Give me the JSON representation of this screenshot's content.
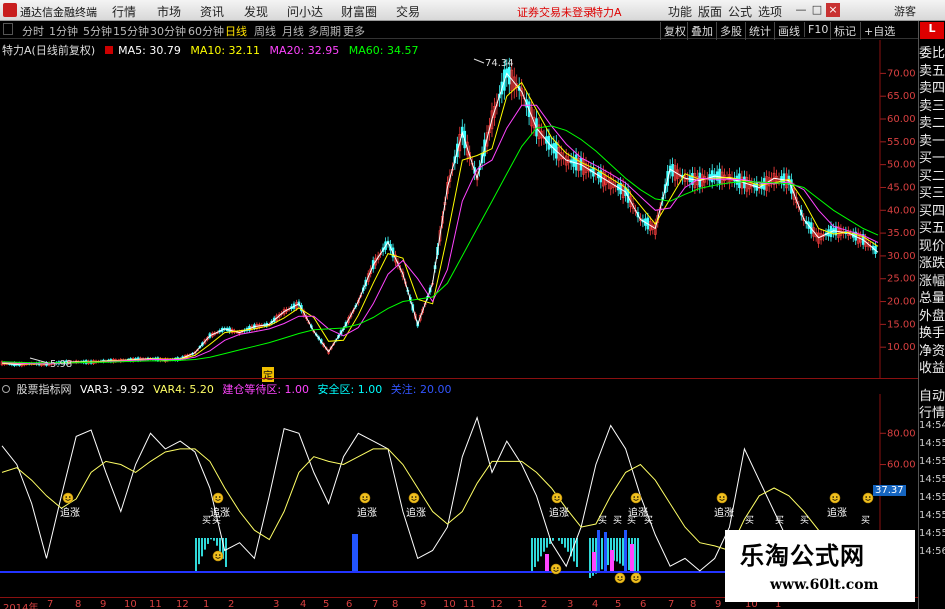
{
  "titlebar": {
    "app_title": "通达信金融终端",
    "menus": [
      "行情",
      "市场",
      "资讯",
      "发现",
      "问小达",
      "财富圈",
      "交易"
    ],
    "status_text": "证券交易未登录",
    "stock_name": "特力A",
    "right_menus": [
      "功能",
      "版面",
      "公式",
      "选项"
    ],
    "user": "游客",
    "win_buttons": [
      "—",
      "□",
      "×"
    ]
  },
  "period_bar": {
    "items": [
      "分时",
      "1分钟",
      "5分钟",
      "15分钟",
      "30分钟",
      "60分钟",
      "日线",
      "周线",
      "月线",
      "多周期",
      "更多"
    ],
    "active": "日线",
    "right_items": [
      "复权",
      "叠加",
      "多股",
      "统计",
      "画线",
      "F10",
      "标记",
      "+自选"
    ],
    "right_box": "L"
  },
  "main_chart": {
    "title": "特力A(日线前复权)",
    "ma": [
      {
        "label": "MA5: 30.79",
        "color": "#ffffff"
      },
      {
        "label": "MA10: 32.11",
        "color": "#ffff00"
      },
      {
        "label": "MA20: 32.95",
        "color": "#ff44ff"
      },
      {
        "label": "MA60: 34.57",
        "color": "#00ff00"
      }
    ],
    "high_label": "74.34",
    "low_label": "5.98",
    "marker": "定"
  },
  "sub_chart": {
    "name": "股票指标网",
    "labels": [
      {
        "label": "VAR3: -9.92",
        "color": "#ffffff"
      },
      {
        "label": "VAR4: 5.20",
        "color": "#ffff66"
      },
      {
        "label": "建仓等待区: 1.00",
        "color": "#ff44ff"
      },
      {
        "label": "安全区: 1.00",
        "color": "#00ffff"
      },
      {
        "label": "关注: 20.00",
        "color": "#3355ff"
      }
    ],
    "signal": "追涨",
    "buy": "买",
    "badge": "37.37"
  },
  "right_panel": {
    "items": [
      "委比",
      "卖五",
      "卖四",
      "卖三",
      "卖二",
      "卖一",
      "买一",
      "买二",
      "买三",
      "买四",
      "买五",
      "现价",
      "涨跌",
      "涨幅",
      "总量",
      "外盘",
      "换手",
      "净资",
      "收益"
    ],
    "lower_items": [
      "自动",
      "行情"
    ],
    "times": [
      "14:54",
      "14:55",
      "14:55",
      "14:55",
      "14:55",
      "14:55",
      "14:55",
      "14:56"
    ],
    "box_label": "L"
  },
  "date_axis": {
    "labels": [
      "2014年",
      "7",
      "8",
      "9",
      "10",
      "11",
      "12",
      "1",
      "2",
      "3",
      "4",
      "5",
      "6",
      "7",
      "8",
      "9",
      "10",
      "11",
      "12",
      "1",
      "2",
      "3",
      "4",
      "5",
      "6",
      "7",
      "8",
      "9",
      "10",
      "1"
    ]
  },
  "watermark": {
    "title": "乐淘公式网",
    "url": "www.60lt.com"
  },
  "chart_data": [
    {
      "type": "line",
      "title": "特力A(日线前复权)",
      "y_ticks": [
        "70.00",
        "65.00",
        "60.00",
        "55.00",
        "50.00",
        "45.00",
        "40.00",
        "35.00",
        "30.00",
        "25.00",
        "20.00",
        "15.00",
        "10.00"
      ],
      "ylim": [
        5,
        76
      ],
      "series": [
        {
          "name": "MA5",
          "color": "#ffffff",
          "values": [
            6.5,
            6.2,
            6.4,
            6.3,
            6.6,
            6.8,
            6.7,
            7.0,
            7.1,
            7.3,
            7.5,
            7.2,
            7.4,
            8.8,
            12.5,
            14.0,
            13.2,
            14.5,
            15.0,
            17.8,
            19.5,
            13.5,
            9.0,
            14.0,
            20.0,
            28.0,
            33.0,
            26.0,
            15.0,
            24.0,
            45.0,
            57.0,
            47.0,
            60.0,
            70.0,
            66.0,
            58.0,
            54.0,
            51.0,
            50.0,
            48.0,
            46.0,
            44.0,
            38.0,
            36.0,
            49.0,
            47.0,
            46.5,
            47.5,
            47.0,
            46.0,
            45.0,
            47.0,
            46.5,
            38.0,
            34.0,
            35.5,
            35.0,
            33.5,
            30.8
          ]
        },
        {
          "name": "MA10",
          "color": "#ffff00",
          "values": [
            6.6,
            6.4,
            6.3,
            6.4,
            6.5,
            6.7,
            6.8,
            6.9,
            7.1,
            7.2,
            7.4,
            7.4,
            7.4,
            8.2,
            10.6,
            13.2,
            13.6,
            14.0,
            14.7,
            16.4,
            18.6,
            16.5,
            11.3,
            11.5,
            17.0,
            24.0,
            30.5,
            29.5,
            20.5,
            19.5,
            34.5,
            51.0,
            52.0,
            53.5,
            65.0,
            68.0,
            62.0,
            56.0,
            52.5,
            50.5,
            49.0,
            47.0,
            45.0,
            41.0,
            37.0,
            42.5,
            48.0,
            46.8,
            47.0,
            47.2,
            46.5,
            45.5,
            46.0,
            46.8,
            42.0,
            36.0,
            34.8,
            35.2,
            34.2,
            32.1
          ]
        },
        {
          "name": "MA20",
          "color": "#ff44ff",
          "values": [
            6.7,
            6.5,
            6.4,
            6.4,
            6.5,
            6.6,
            6.7,
            6.8,
            7.0,
            7.1,
            7.3,
            7.3,
            7.3,
            7.8,
            9.2,
            11.5,
            12.8,
            13.4,
            14.0,
            15.2,
            16.8,
            16.8,
            14.0,
            12.5,
            14.3,
            19.5,
            26.0,
            29.0,
            25.0,
            20.0,
            27.0,
            42.0,
            49.0,
            51.0,
            58.0,
            63.0,
            63.0,
            58.5,
            54.5,
            51.5,
            49.8,
            48.0,
            46.0,
            43.0,
            40.0,
            40.5,
            45.0,
            47.0,
            46.8,
            46.8,
            46.7,
            46.0,
            45.8,
            46.2,
            44.5,
            40.0,
            36.5,
            35.5,
            34.5,
            32.95
          ]
        },
        {
          "name": "MA60",
          "color": "#00ff00",
          "values": [
            6.8,
            6.7,
            6.6,
            6.6,
            6.6,
            6.6,
            6.7,
            6.7,
            6.8,
            6.9,
            7.0,
            7.0,
            7.1,
            7.3,
            7.8,
            8.6,
            9.4,
            10.2,
            11.0,
            12.0,
            13.0,
            13.8,
            14.0,
            14.2,
            15.0,
            16.5,
            18.5,
            20.0,
            20.5,
            21.0,
            24.0,
            30.0,
            36.0,
            42.0,
            48.0,
            54.0,
            58.0,
            58.5,
            57.5,
            55.5,
            53.0,
            50.0,
            47.0,
            44.5,
            42.5,
            42.0,
            43.5,
            44.8,
            45.5,
            46.0,
            46.3,
            46.2,
            46.0,
            45.8,
            45.0,
            42.5,
            40.0,
            38.0,
            36.0,
            34.57
          ]
        }
      ]
    },
    {
      "type": "line",
      "title": "股票指标网",
      "y_ticks": [
        "80.00",
        "60.00"
      ],
      "ylim": [
        -10,
        100
      ],
      "series": [
        {
          "name": "VAR3",
          "color": "#ffffff",
          "values": [
            72,
            60,
            35,
            0,
            40,
            78,
            82,
            55,
            30,
            60,
            80,
            70,
            75,
            68,
            45,
            5,
            10,
            0,
            40,
            83,
            80,
            55,
            35,
            65,
            80,
            75,
            70,
            30,
            0,
            5,
            20,
            65,
            90,
            55,
            75,
            60,
            40,
            10,
            -5,
            20,
            60,
            85,
            70,
            40,
            15,
            -5,
            0,
            -8,
            0,
            20,
            70,
            50,
            30,
            10,
            5,
            -2,
            15,
            -5,
            -9.92,
            -9.92
          ]
        },
        {
          "name": "VAR4",
          "color": "#ffff66",
          "values": [
            55,
            58,
            50,
            40,
            32,
            38,
            55,
            62,
            60,
            55,
            62,
            68,
            70,
            70,
            62,
            45,
            30,
            18,
            12,
            30,
            55,
            65,
            62,
            60,
            65,
            70,
            70,
            60,
            45,
            30,
            22,
            30,
            48,
            62,
            62,
            62,
            55,
            45,
            32,
            20,
            22,
            40,
            55,
            60,
            50,
            35,
            20,
            10,
            8,
            5,
            25,
            40,
            45,
            40,
            30,
            18,
            12,
            8,
            6,
            5.2
          ]
        }
      ]
    }
  ]
}
